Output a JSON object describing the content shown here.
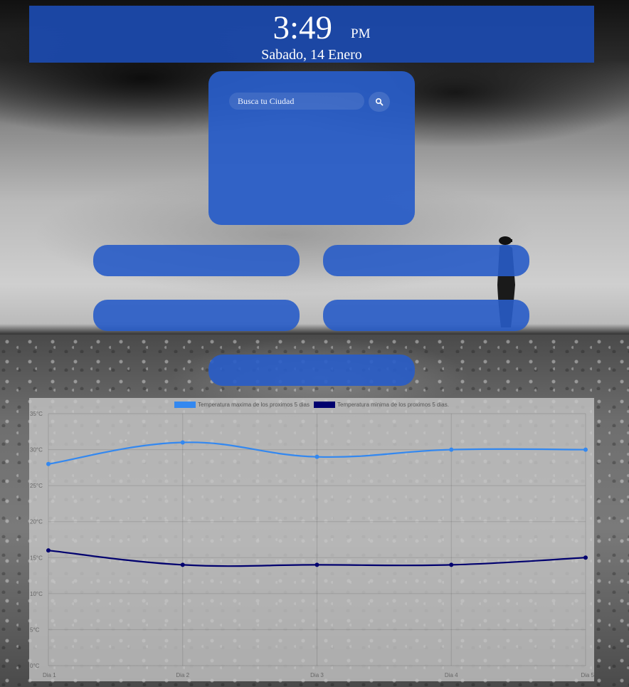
{
  "header": {
    "time": "3:49",
    "ampm": "PM",
    "date": "Sabado, 14 Enero"
  },
  "search": {
    "placeholder": "Busca tu Ciudad",
    "button_icon": "search-icon"
  },
  "colors": {
    "panel": "#2c5cc8",
    "header": "#1c48a8",
    "max_series": "#3388f0",
    "min_series": "#00006e"
  },
  "chart_data": {
    "type": "line",
    "categories": [
      "Dia 1",
      "Dia 2",
      "Dia 3",
      "Dia 4",
      "Dia 5"
    ],
    "series": [
      {
        "name": "Temperatura maxima de los proximos 5 dias",
        "values": [
          28,
          31,
          29,
          30,
          30
        ],
        "color": "#3388f0"
      },
      {
        "name": "Temperatura minima de los proximos 5 dias.",
        "values": [
          16,
          14,
          14,
          14,
          15
        ],
        "color": "#00006e"
      }
    ],
    "y_ticks": [
      "0°C",
      "5°C",
      "10°C",
      "15°C",
      "20°C",
      "25°C",
      "30°C",
      "35°C"
    ],
    "ylim": [
      0,
      35
    ],
    "grid": true,
    "legend_position": "top-center"
  }
}
